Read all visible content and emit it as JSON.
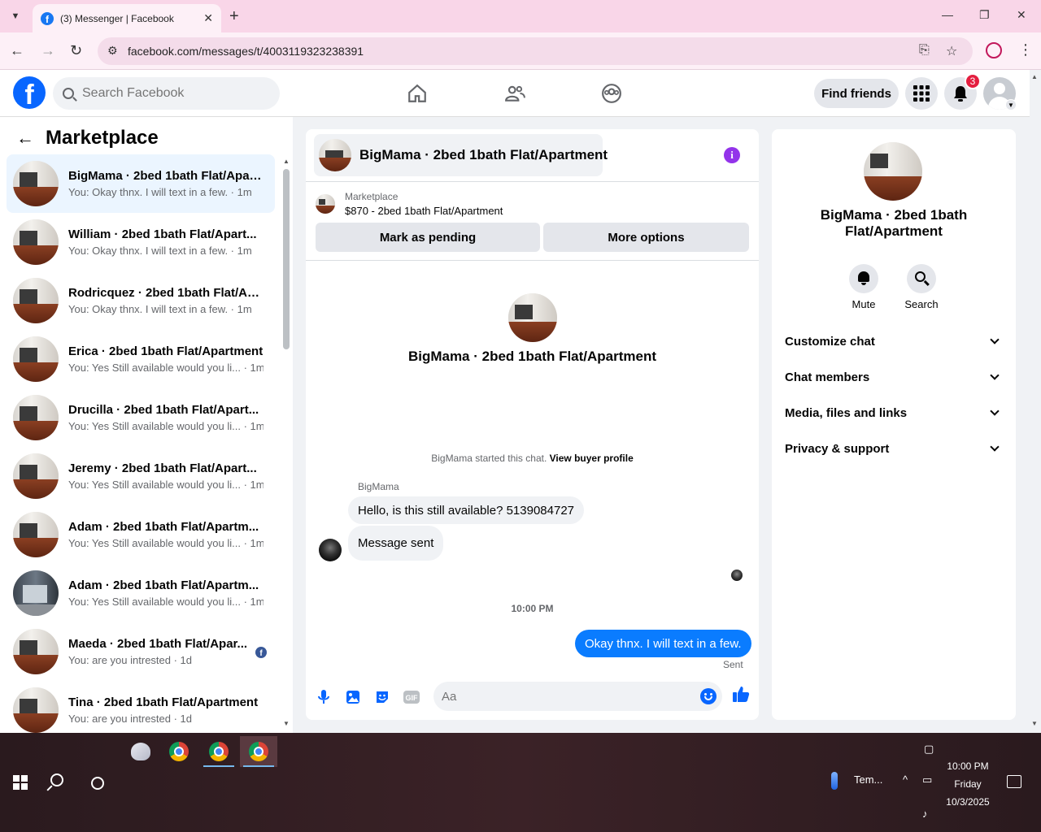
{
  "browser": {
    "tab_title": "(3) Messenger | Facebook",
    "url": "facebook.com/messages/t/4003119323238391"
  },
  "fb": {
    "search_placeholder": "Search Facebook",
    "find_friends": "Find friends",
    "notif_count": "3"
  },
  "left": {
    "title": "Marketplace",
    "conversations": [
      {
        "name": "BigMama · 2bed 1bath Flat/Apar...",
        "snippet": "You: Okay thnx. I will text in a few. · 1m",
        "active": true
      },
      {
        "name": "William · 2bed 1bath Flat/Apart...",
        "snippet": "You: Okay thnx. I will text in a few. · 1m"
      },
      {
        "name": "Rodricquez · 2bed 1bath Flat/Ap...",
        "snippet": "You: Okay thnx. I will text in a few. · 1m"
      },
      {
        "name": "Erica · 2bed 1bath Flat/Apartment",
        "snippet": "You: Yes Still available would you li... · 1m"
      },
      {
        "name": "Drucilla · 2bed 1bath Flat/Apart...",
        "snippet": "You: Yes Still available would you li... · 1m"
      },
      {
        "name": "Jeremy · 2bed 1bath Flat/Apart...",
        "snippet": "You: Yes Still available would you li... · 1m"
      },
      {
        "name": "Adam · 2bed 1bath Flat/Apartm...",
        "snippet": "You: Yes Still available would you li... · 1m"
      },
      {
        "name": "Adam · 2bed 1bath Flat/Apartm...",
        "snippet": "You: Yes Still available would you li... · 1m"
      },
      {
        "name": "Maeda · 2bed 1bath Flat/Apar...",
        "snippet": "You: are you intrested · 1d"
      },
      {
        "name": "Tina · 2bed 1bath Flat/Apartment",
        "snippet": "You: are you intrested · 1d"
      }
    ]
  },
  "chat": {
    "header_title": "BigMama · 2bed 1bath Flat/Apartment",
    "marketplace_label": "Marketplace",
    "listing": "$870 - 2bed 1bath Flat/Apartment",
    "mark_pending": "Mark as pending",
    "more_options": "More options",
    "center_name": "BigMama · 2bed 1bath Flat/Apartment",
    "started_text": "BigMama started this chat.",
    "view_buyer": "View buyer profile",
    "sender": "BigMama",
    "msg1": "Hello, is this still available? 5139084727",
    "msg2": "Message sent",
    "timestamp": "10:00 PM",
    "outgoing": "Okay thnx. I will text in a few.",
    "sent_label": "Sent",
    "input_placeholder": "Aa"
  },
  "right": {
    "name": "BigMama · 2bed 1bath Flat/Apartment",
    "mute": "Mute",
    "search": "Search",
    "sections": [
      "Customize chat",
      "Chat members",
      "Media, files and links",
      "Privacy & support"
    ]
  },
  "taskbar": {
    "weather": "Tem...",
    "time": "10:00 PM",
    "day": "Friday",
    "date": "10/3/2025"
  }
}
